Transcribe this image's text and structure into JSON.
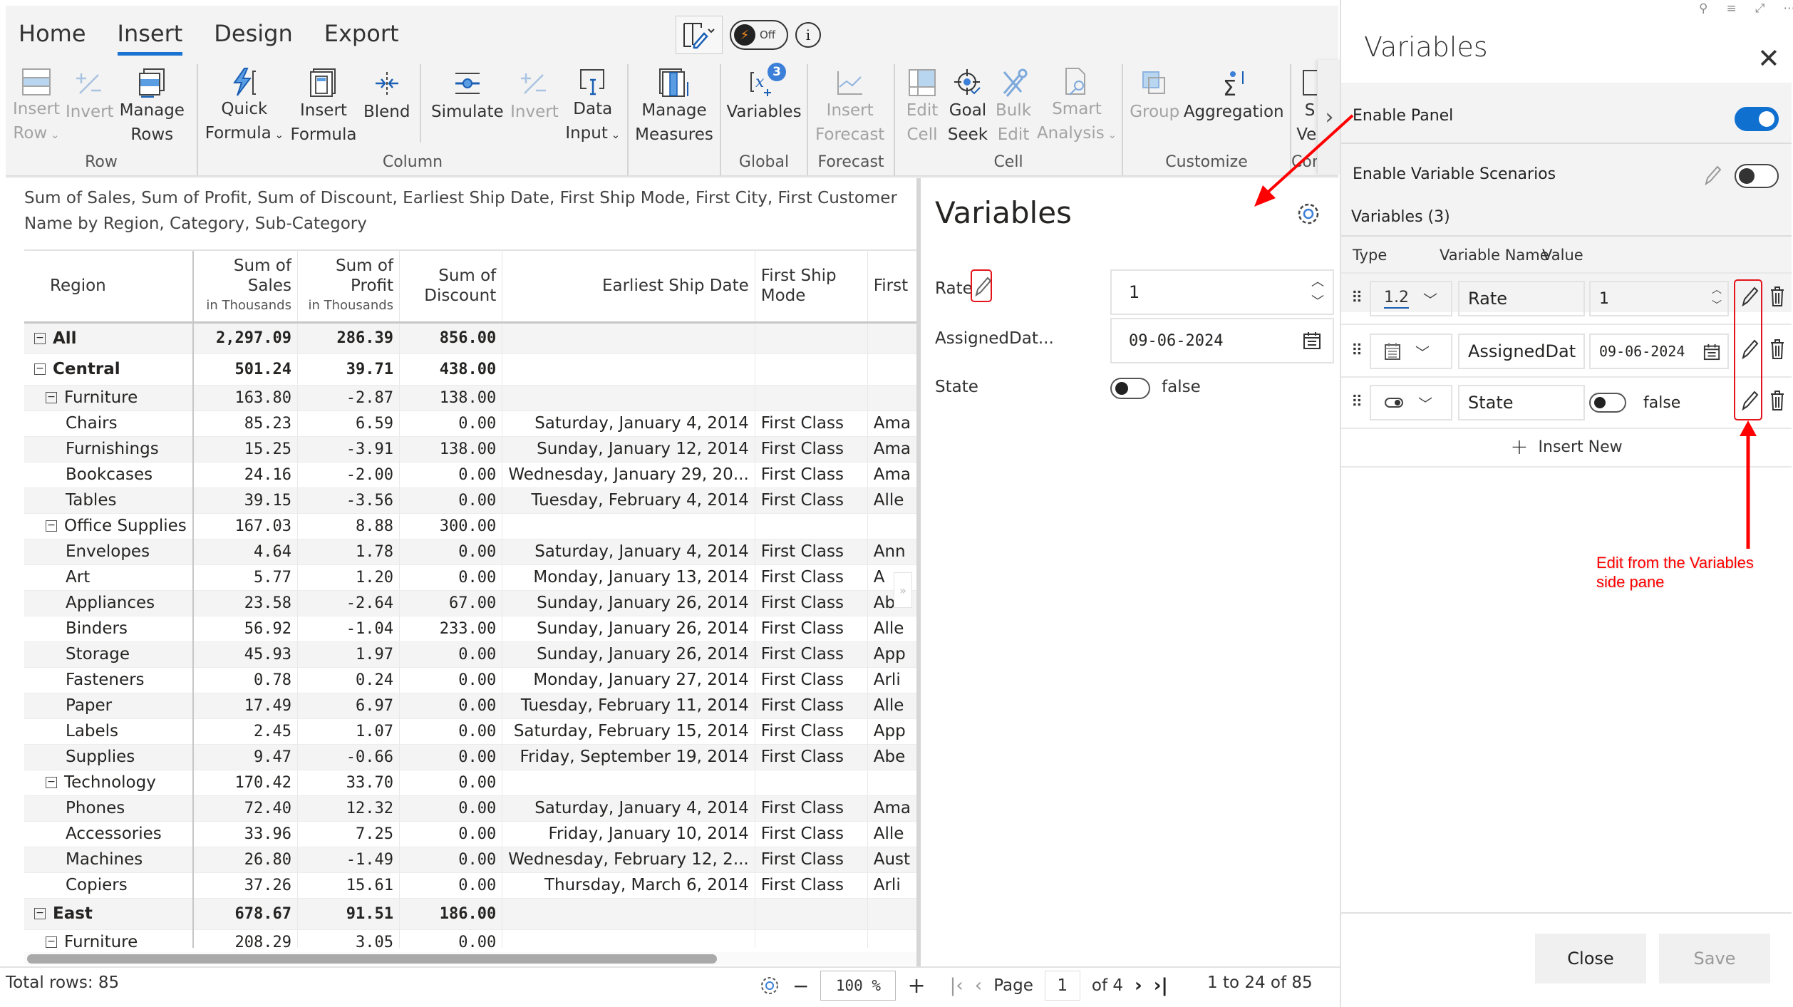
{
  "ribbon": {
    "tabs": [
      {
        "label": "Home",
        "active": false
      },
      {
        "label": "Insert",
        "active": true
      },
      {
        "label": "Design",
        "active": false
      },
      {
        "label": "Export",
        "active": false
      }
    ],
    "toggle_state": "Off",
    "groups": [
      {
        "label": "Row",
        "buttons": [
          {
            "line1": "Insert",
            "line2": "Row",
            "dropdown": true,
            "disabled": true,
            "icon": "insert-row-icon"
          },
          {
            "line1": "Invert",
            "line2": "",
            "disabled": true,
            "icon": "invert-icon"
          },
          {
            "line1": "Manage",
            "line2": "Rows",
            "disabled": false,
            "icon": "manage-rows-icon"
          }
        ]
      },
      {
        "label": "Column",
        "buttons": [
          {
            "line1": "Quick",
            "line2": "Formula",
            "dropdown": true,
            "disabled": false,
            "icon": "lightning-icon"
          },
          {
            "line1": "Insert",
            "line2": "Formula",
            "disabled": false,
            "icon": "calculator-icon"
          },
          {
            "line1": "Blend",
            "line2": "",
            "disabled": false,
            "icon": "blend-icon"
          },
          {
            "line1": "Simulate",
            "line2": "",
            "disabled": false,
            "icon": "simulate-icon"
          },
          {
            "line1": "Invert",
            "line2": "",
            "disabled": true,
            "icon": "invert-icon"
          },
          {
            "line1": "Data",
            "line2": "Input",
            "dropdown": true,
            "disabled": false,
            "icon": "data-input-icon"
          }
        ]
      },
      {
        "label": "",
        "buttons": [
          {
            "line1": "Manage",
            "line2": "Measures",
            "disabled": false,
            "icon": "manage-measures-icon"
          }
        ]
      },
      {
        "label": "Global",
        "buttons": [
          {
            "line1": "Variables",
            "line2": "",
            "disabled": false,
            "icon": "variables-icon",
            "badge": "3"
          }
        ]
      },
      {
        "label": "Forecast",
        "buttons": [
          {
            "line1": "Insert",
            "line2": "Forecast",
            "disabled": true,
            "icon": "forecast-icon"
          }
        ]
      },
      {
        "label": "Cell",
        "buttons": [
          {
            "line1": "Edit",
            "line2": "Cell",
            "disabled": true,
            "icon": "edit-cell-icon"
          },
          {
            "line1": "Goal",
            "line2": "Seek",
            "disabled": false,
            "icon": "goal-seek-icon"
          },
          {
            "line1": "Bulk",
            "line2": "Edit",
            "disabled": true,
            "icon": "bulk-edit-icon"
          },
          {
            "line1": "Smart",
            "line2": "Analysis",
            "dropdown": true,
            "disabled": true,
            "icon": "smart-analysis-icon"
          }
        ]
      },
      {
        "label": "Customize",
        "buttons": [
          {
            "line1": "Group",
            "line2": "",
            "disabled": true,
            "icon": "group-icon"
          },
          {
            "line1": "Aggregation",
            "line2": "",
            "disabled": false,
            "icon": "aggregation-icon"
          }
        ]
      },
      {
        "label": "Con",
        "buttons": [
          {
            "line1": "S",
            "line2": "Ver",
            "disabled": false,
            "icon": "database-icon"
          }
        ]
      }
    ]
  },
  "report": {
    "subtitle": "Sum of Sales, Sum of Profit, Sum of Discount, Earliest Ship Date, First Ship Mode, First City, First Customer Name by Region, Category, Sub-Category",
    "columns": [
      {
        "title": "Region",
        "sub": ""
      },
      {
        "title": "Sum of Sales",
        "sub": "in Thousands"
      },
      {
        "title": "Sum of Profit",
        "sub": "in Thousands"
      },
      {
        "title": "Sum of Discount",
        "sub": ""
      },
      {
        "title": "Earliest Ship Date",
        "sub": ""
      },
      {
        "title": "First Ship Mode",
        "sub": ""
      },
      {
        "title": "First",
        "sub": ""
      }
    ],
    "rows": [
      {
        "level": 0,
        "label": "All",
        "expand": true,
        "sales": "2,297.09",
        "profit": "286.39",
        "discount": "856.00",
        "date": "",
        "mode": "",
        "first": ""
      },
      {
        "level": 0,
        "label": "Central",
        "expand": true,
        "sales": "501.24",
        "profit": "39.71",
        "discount": "438.00",
        "date": "",
        "mode": "",
        "first": ""
      },
      {
        "level": 1,
        "label": "Furniture",
        "expand": true,
        "sales": "163.80",
        "profit": "-2.87",
        "discount": "138.00",
        "date": "",
        "mode": "",
        "first": ""
      },
      {
        "level": 2,
        "label": "Chairs",
        "sales": "85.23",
        "profit": "6.59",
        "discount": "0.00",
        "date": "Saturday, January 4, 2014",
        "mode": "First Class",
        "first": "Ama"
      },
      {
        "level": 2,
        "label": "Furnishings",
        "sales": "15.25",
        "profit": "-3.91",
        "discount": "138.00",
        "date": "Sunday, January 12, 2014",
        "mode": "First Class",
        "first": "Ama"
      },
      {
        "level": 2,
        "label": "Bookcases",
        "sales": "24.16",
        "profit": "-2.00",
        "discount": "0.00",
        "date": "Wednesday, January 29, 20...",
        "mode": "First Class",
        "first": "Ama"
      },
      {
        "level": 2,
        "label": "Tables",
        "sales": "39.15",
        "profit": "-3.56",
        "discount": "0.00",
        "date": "Tuesday, February 4, 2014",
        "mode": "First Class",
        "first": "Alle"
      },
      {
        "level": 1,
        "label": "Office Supplies",
        "expand": true,
        "sales": "167.03",
        "profit": "8.88",
        "discount": "300.00",
        "date": "",
        "mode": "",
        "first": ""
      },
      {
        "level": 2,
        "label": "Envelopes",
        "sales": "4.64",
        "profit": "1.78",
        "discount": "0.00",
        "date": "Saturday, January 4, 2014",
        "mode": "First Class",
        "first": "Ann"
      },
      {
        "level": 2,
        "label": "Art",
        "sales": "5.77",
        "profit": "1.20",
        "discount": "0.00",
        "date": "Monday, January 13, 2014",
        "mode": "First Class",
        "first": "A"
      },
      {
        "level": 2,
        "label": "Appliances",
        "sales": "23.58",
        "profit": "-2.64",
        "discount": "67.00",
        "date": "Sunday, January 26, 2014",
        "mode": "First Class",
        "first": "Ab"
      },
      {
        "level": 2,
        "label": "Binders",
        "sales": "56.92",
        "profit": "-1.04",
        "discount": "233.00",
        "date": "Sunday, January 26, 2014",
        "mode": "First Class",
        "first": "Alle"
      },
      {
        "level": 2,
        "label": "Storage",
        "sales": "45.93",
        "profit": "1.97",
        "discount": "0.00",
        "date": "Sunday, January 26, 2014",
        "mode": "First Class",
        "first": "App"
      },
      {
        "level": 2,
        "label": "Fasteners",
        "sales": "0.78",
        "profit": "0.24",
        "discount": "0.00",
        "date": "Monday, January 27, 2014",
        "mode": "First Class",
        "first": "Arli"
      },
      {
        "level": 2,
        "label": "Paper",
        "sales": "17.49",
        "profit": "6.97",
        "discount": "0.00",
        "date": "Tuesday, February 11, 2014",
        "mode": "First Class",
        "first": "Alle"
      },
      {
        "level": 2,
        "label": "Labels",
        "sales": "2.45",
        "profit": "1.07",
        "discount": "0.00",
        "date": "Saturday, February 15, 2014",
        "mode": "First Class",
        "first": "App"
      },
      {
        "level": 2,
        "label": "Supplies",
        "sales": "9.47",
        "profit": "-0.66",
        "discount": "0.00",
        "date": "Friday, September 19, 2014",
        "mode": "First Class",
        "first": "Abe"
      },
      {
        "level": 1,
        "label": "Technology",
        "expand": true,
        "sales": "170.42",
        "profit": "33.70",
        "discount": "0.00",
        "date": "",
        "mode": "",
        "first": ""
      },
      {
        "level": 2,
        "label": "Phones",
        "sales": "72.40",
        "profit": "12.32",
        "discount": "0.00",
        "date": "Saturday, January 4, 2014",
        "mode": "First Class",
        "first": "Ama"
      },
      {
        "level": 2,
        "label": "Accessories",
        "sales": "33.96",
        "profit": "7.25",
        "discount": "0.00",
        "date": "Friday, January 10, 2014",
        "mode": "First Class",
        "first": "Alle"
      },
      {
        "level": 2,
        "label": "Machines",
        "sales": "26.80",
        "profit": "-1.49",
        "discount": "0.00",
        "date": "Wednesday, February 12, 2...",
        "mode": "First Class",
        "first": "Aust"
      },
      {
        "level": 2,
        "label": "Copiers",
        "sales": "37.26",
        "profit": "15.61",
        "discount": "0.00",
        "date": "Thursday, March 6, 2014",
        "mode": "First Class",
        "first": "Arli"
      },
      {
        "level": 0,
        "label": "East",
        "expand": true,
        "sales": "678.67",
        "profit": "91.51",
        "discount": "186.00",
        "date": "",
        "mode": "",
        "first": ""
      },
      {
        "level": 1,
        "label": "Furniture",
        "expand": true,
        "sales": "208.29",
        "profit": "3.05",
        "discount": "0.00",
        "date": "",
        "mode": "",
        "first": ""
      }
    ]
  },
  "footer": {
    "total_rows": "Total rows: 85",
    "zoom": "100 %",
    "page_label": "Page",
    "page": "1",
    "of_pages": "of 4",
    "range": "1 to 24 of 85"
  },
  "variables_card": {
    "title": "Variables",
    "items": [
      {
        "label": "Rate",
        "value": "1",
        "kind": "number"
      },
      {
        "label": "AssignedDat...",
        "value": "09-06-2024",
        "kind": "date"
      },
      {
        "label": "State",
        "value": "false",
        "kind": "boolean"
      }
    ]
  },
  "side_pane": {
    "title": "Variables",
    "enable_panel_label": "Enable Panel",
    "enable_panel_on": true,
    "enable_scenarios_label": "Enable Variable Scenarios",
    "enable_scenarios_on": false,
    "variables_count_label": "Variables (3)",
    "col_type": "Type",
    "col_name": "Variable Name",
    "col_value": "Value",
    "rows": [
      {
        "type_label": "1.2",
        "type_icon": "number-type-icon",
        "name": "Rate",
        "value": "1",
        "kind": "number"
      },
      {
        "type_label": "",
        "type_icon": "calendar-type-icon",
        "name": "AssignedDat",
        "value": "09-06-2024",
        "kind": "date"
      },
      {
        "type_label": "",
        "type_icon": "toggle-type-icon",
        "name": "State",
        "value": "false",
        "kind": "boolean"
      }
    ],
    "insert_new": "Insert New",
    "close": "Close",
    "save": "Save"
  },
  "annotation": {
    "text_line1": "Edit from the Variables",
    "text_line2": "side pane",
    "color": "#ff0000"
  },
  "colors": {
    "accent": "#1a73d1",
    "toggle_on": "#1070d0",
    "badge": "#3c7fd8"
  }
}
